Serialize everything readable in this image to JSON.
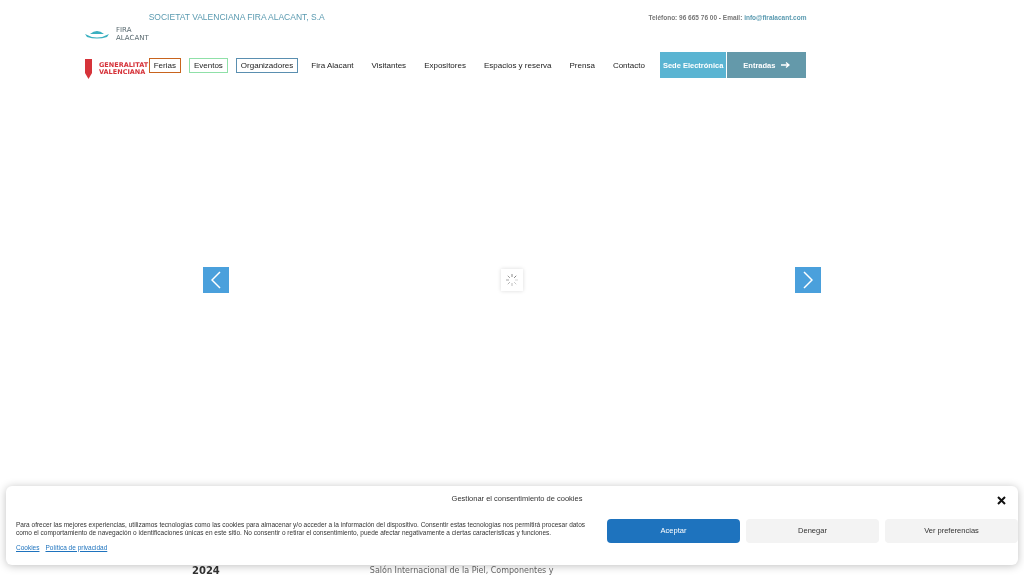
{
  "header": {
    "company": "SOCIETAT VALENCIANA FIRA ALACANT, S.A",
    "contact": {
      "phone_label": "Teléfono: 96 665 76 00 - Email:",
      "email": "info@firalacant.com"
    },
    "logo": {
      "line_1": "FIRA",
      "line_2": "ALACANT"
    },
    "gov_logo": {
      "line_1": "GENERALITAT",
      "line_2": "VALENCIANA"
    }
  },
  "nav": [
    {
      "label": "Ferias",
      "kind": "outlined",
      "color": "#c8641e"
    },
    {
      "label": "Eventos",
      "kind": "outlined",
      "color": "#8fe0a8"
    },
    {
      "label": "Organizadores",
      "kind": "outlined",
      "color": "#5a8fb0"
    },
    {
      "label": "Fira Alacant",
      "kind": "plain"
    },
    {
      "label": "Visitantes",
      "kind": "plain"
    },
    {
      "label": "Expositores",
      "kind": "plain"
    },
    {
      "label": "Espacios y reserva",
      "kind": "plain"
    },
    {
      "label": "Prensa",
      "kind": "plain"
    },
    {
      "label": "Contacto",
      "kind": "plain"
    },
    {
      "label": "Sede Electrónica",
      "kind": "button",
      "color": "#5ab4d2"
    },
    {
      "label": "Entradas",
      "kind": "arrow-button",
      "color": "#6499aa"
    }
  ],
  "below": {
    "year": "2024",
    "title": "Salón Internacional de la Piel, Componentes y"
  },
  "cookie_banner": {
    "title": "Gestionar el consentimiento de cookies",
    "text": "Para ofrecer las mejores experiencias, utilizamos tecnologías como las cookies para almacenar y/o acceder a la información del dispositivo. Consentir estas tecnologías nos permitirá procesar datos como el comportamiento de navegación o identificaciones únicas en este sitio. No consentir o retirar el consentimiento, puede afectar negativamente a ciertas características y funciones.",
    "links": [
      "Cookies",
      "Política de privacidad"
    ],
    "buttons": [
      {
        "label": "Aceptar",
        "kind": "primary"
      },
      {
        "label": "Denegar",
        "kind": "secondary"
      },
      {
        "label": "Ver preferencias",
        "kind": "secondary"
      }
    ]
  }
}
